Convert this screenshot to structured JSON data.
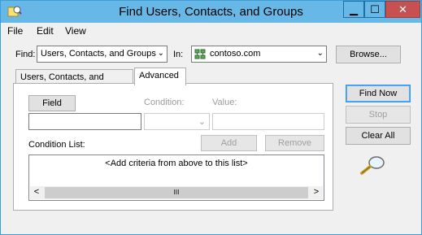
{
  "window": {
    "title": "Find Users, Contacts, and Groups",
    "controls": {
      "minimize": "▁",
      "maximize": "☐",
      "close": "✕"
    }
  },
  "menu": [
    "File",
    "Edit",
    "View"
  ],
  "find": {
    "label": "Find:",
    "value": "Users, Contacts, and Groups",
    "in_label": "In:",
    "in_value": "contoso.com",
    "browse": "Browse..."
  },
  "tabs": [
    "Users, Contacts, and Groups",
    "Advanced"
  ],
  "active_tab": "Advanced",
  "advanced": {
    "field_button": "Field",
    "condition_label": "Condition:",
    "value_label": "Value:",
    "add_button": "Add",
    "remove_button": "Remove",
    "condition_list_label": "Condition List:",
    "list_placeholder": "<Add criteria from above to this list>",
    "scroll_left": "<",
    "scroll_right": ">",
    "scroll_thumb": "III"
  },
  "actions": {
    "find_now": "Find Now",
    "stop": "Stop",
    "clear_all": "Clear All"
  },
  "icons": {
    "app": "address-book-icon",
    "domain": "domain-tree-icon",
    "search": "magnifier-icon",
    "accent": "#67b8e6",
    "close_red": "#c75050"
  }
}
